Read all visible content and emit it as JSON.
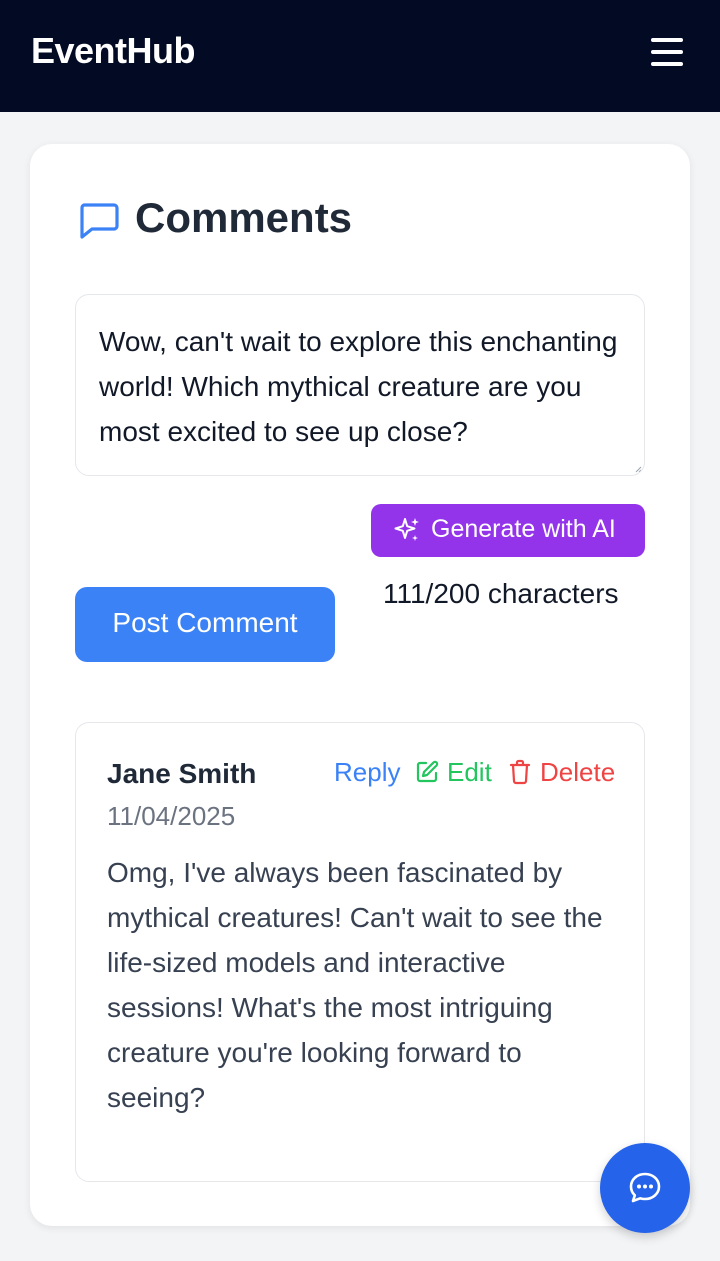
{
  "header": {
    "brand": "EventHub",
    "menu_icon": "hamburger-menu-icon",
    "background_color": "#020a24"
  },
  "comments_section": {
    "title": "Comments",
    "title_icon": "chat-bubble-icon",
    "input": {
      "value": "Wow, can't wait to explore this enchanting world! Which mythical creature are you most excited to see up close?"
    },
    "ai_button": {
      "label": "Generate with AI",
      "icon": "sparkles-icon",
      "color": "#9333ea"
    },
    "char_count": "111/200 characters",
    "post_button": {
      "label": "Post Comment",
      "color": "#3b82f6"
    },
    "comments": [
      {
        "author": "Jane Smith",
        "date": "11/04/2025",
        "actions": {
          "reply": "Reply",
          "edit": "Edit",
          "delete": "Delete"
        },
        "body": "Omg, I've always been fascinated by mythical creatures! Can't wait to see the life-sized models and interactive sessions! What's the most intriguing creature you're looking forward to seeing?"
      }
    ]
  },
  "fab": {
    "icon": "chat-dots-icon",
    "color": "#2563eb"
  }
}
